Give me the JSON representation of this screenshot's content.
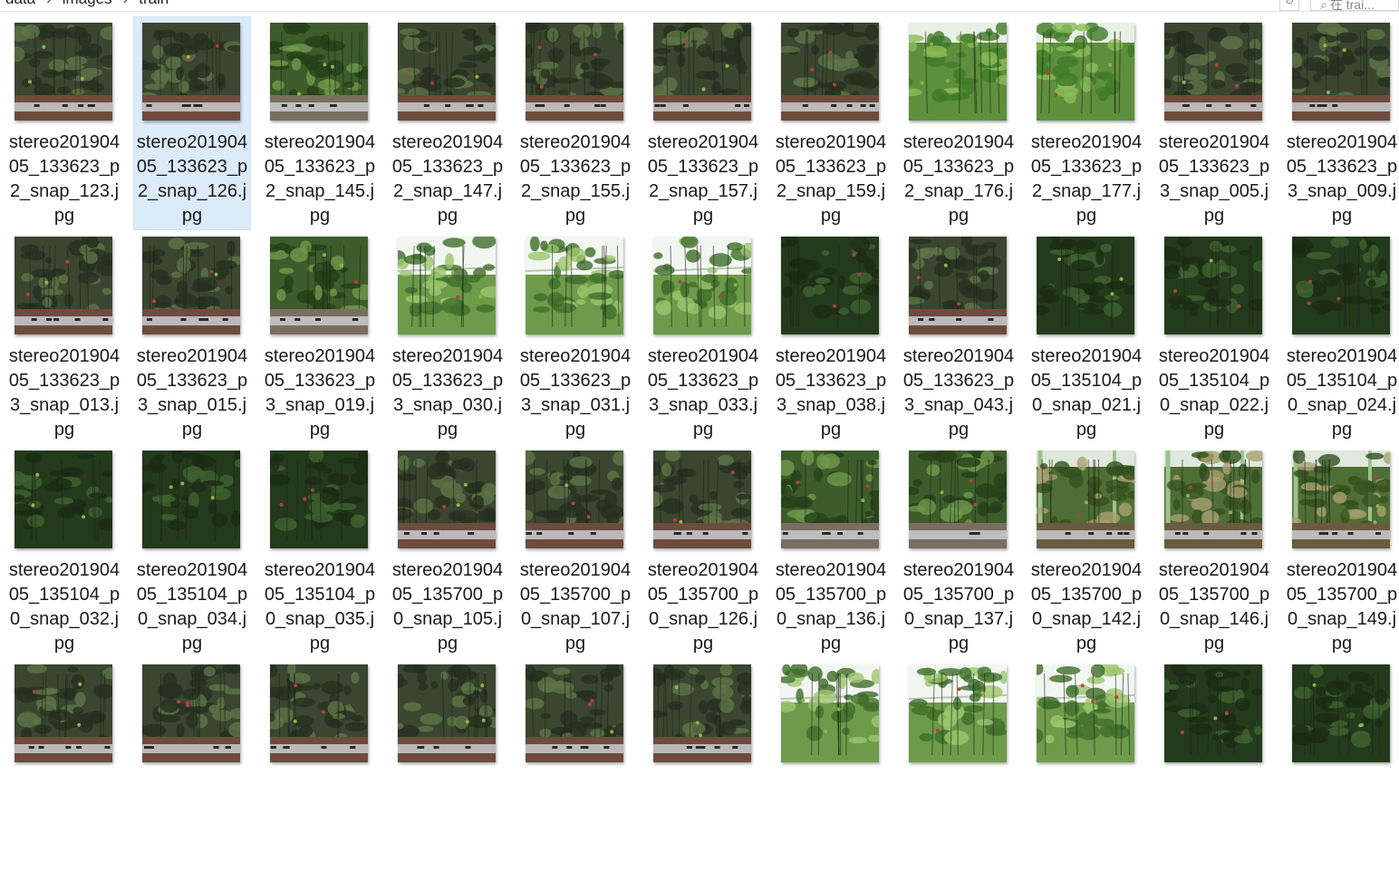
{
  "breadcrumb": [
    "data",
    "images",
    "train"
  ],
  "breadcrumb_separator": "›",
  "search": {
    "placeholder": "在 trai..."
  },
  "colors": {
    "selection": "#dcebfa",
    "foliage": "#2f4a22",
    "soil": "#6b4a3a"
  },
  "files": [
    {
      "name": "stereo20190405_133623_p2_snap_123.jpg",
      "style": "dark",
      "selected": false
    },
    {
      "name": "stereo20190405_133623_p2_snap_126.jpg",
      "style": "dark",
      "selected": true
    },
    {
      "name": "stereo20190405_133623_p2_snap_145.jpg",
      "style": "green",
      "selected": false
    },
    {
      "name": "stereo20190405_133623_p2_snap_147.jpg",
      "style": "dark",
      "selected": false
    },
    {
      "name": "stereo20190405_133623_p2_snap_155.jpg",
      "style": "dark",
      "selected": false
    },
    {
      "name": "stereo20190405_133623_p2_snap_157.jpg",
      "style": "dark",
      "selected": false
    },
    {
      "name": "stereo20190405_133623_p2_snap_159.jpg",
      "style": "dark",
      "selected": false
    },
    {
      "name": "stereo20190405_133623_p2_snap_176.jpg",
      "style": "bright",
      "selected": false
    },
    {
      "name": "stereo20190405_133623_p2_snap_177.jpg",
      "style": "bright",
      "selected": false
    },
    {
      "name": "stereo20190405_133623_p3_snap_005.jpg",
      "style": "dark",
      "selected": false
    },
    {
      "name": "stereo20190405_133623_p3_snap_009.jpg",
      "style": "dark",
      "selected": false
    },
    {
      "name": "stereo20190405_133623_p3_snap_013.jpg",
      "style": "dark",
      "selected": false
    },
    {
      "name": "stereo20190405_133623_p3_snap_015.jpg",
      "style": "dark",
      "selected": false
    },
    {
      "name": "stereo20190405_133623_p3_snap_019.jpg",
      "style": "green",
      "selected": false
    },
    {
      "name": "stereo20190405_133623_p3_snap_030.jpg",
      "style": "sky",
      "selected": false
    },
    {
      "name": "stereo20190405_133623_p3_snap_031.jpg",
      "style": "sky",
      "selected": false
    },
    {
      "name": "stereo20190405_133623_p3_snap_033.jpg",
      "style": "sky",
      "selected": false
    },
    {
      "name": "stereo20190405_133623_p3_snap_038.jpg",
      "style": "deep",
      "selected": false
    },
    {
      "name": "stereo20190405_133623_p3_snap_043.jpg",
      "style": "dark",
      "selected": false
    },
    {
      "name": "stereo20190405_135104_p0_snap_021.jpg",
      "style": "deep",
      "selected": false
    },
    {
      "name": "stereo20190405_135104_p0_snap_022.jpg",
      "style": "deep",
      "selected": false
    },
    {
      "name": "stereo20190405_135104_p0_snap_024.jpg",
      "style": "deep",
      "selected": false
    },
    {
      "name": "stereo20190405_135104_p0_snap_032.jpg",
      "style": "deep",
      "selected": false
    },
    {
      "name": "stereo20190405_135104_p0_snap_034.jpg",
      "style": "deep",
      "selected": false
    },
    {
      "name": "stereo20190405_135104_p0_snap_035.jpg",
      "style": "deep",
      "selected": false
    },
    {
      "name": "stereo20190405_135700_p0_snap_105.jpg",
      "style": "dark",
      "selected": false
    },
    {
      "name": "stereo20190405_135700_p0_snap_107.jpg",
      "style": "dark",
      "selected": false
    },
    {
      "name": "stereo20190405_135700_p0_snap_126.jpg",
      "style": "dark",
      "selected": false
    },
    {
      "name": "stereo20190405_135700_p0_snap_136.jpg",
      "style": "green",
      "selected": false
    },
    {
      "name": "stereo20190405_135700_p0_snap_137.jpg",
      "style": "green",
      "selected": false
    },
    {
      "name": "stereo20190405_135700_p0_snap_142.jpg",
      "style": "frame",
      "selected": false
    },
    {
      "name": "stereo20190405_135700_p0_snap_146.jpg",
      "style": "frame",
      "selected": false
    },
    {
      "name": "stereo20190405_135700_p0_snap_149.jpg",
      "style": "frame",
      "selected": false
    },
    {
      "name": "",
      "style": "dark",
      "selected": false
    },
    {
      "name": "",
      "style": "dark",
      "selected": false
    },
    {
      "name": "",
      "style": "dark",
      "selected": false
    },
    {
      "name": "",
      "style": "dark",
      "selected": false
    },
    {
      "name": "",
      "style": "dark",
      "selected": false
    },
    {
      "name": "",
      "style": "dark",
      "selected": false
    },
    {
      "name": "",
      "style": "sky",
      "selected": false
    },
    {
      "name": "",
      "style": "sky",
      "selected": false
    },
    {
      "name": "",
      "style": "sky",
      "selected": false
    },
    {
      "name": "",
      "style": "deep",
      "selected": false
    },
    {
      "name": "",
      "style": "deep",
      "selected": false
    }
  ]
}
